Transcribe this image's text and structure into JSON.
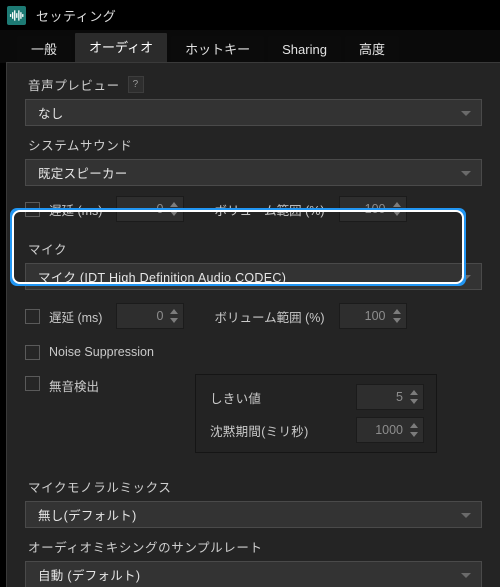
{
  "window": {
    "title": "セッティング",
    "icon": "audio-wave-icon",
    "icon_color": "#1d7a74"
  },
  "tabs": [
    {
      "id": "general",
      "label": "一般",
      "active": false
    },
    {
      "id": "audio",
      "label": "オーディオ",
      "active": true
    },
    {
      "id": "hotkey",
      "label": "ホットキー",
      "active": false
    },
    {
      "id": "sharing",
      "label": "Sharing",
      "active": false
    },
    {
      "id": "advanced",
      "label": "高度",
      "active": false
    }
  ],
  "audio": {
    "preview": {
      "label": "音声プレビュー",
      "help": "?",
      "value": "なし"
    },
    "system_sound": {
      "label": "システムサウンド",
      "value": "既定スピーカー",
      "delay_checkbox_checked": false,
      "delay_label": "遅延 (ms)",
      "delay_value": "0",
      "volume_label": "ボリューム範囲 (%)",
      "volume_value": "100"
    },
    "mic": {
      "label": "マイク",
      "value": "マイク (IDT High Definition Audio CODEC)",
      "delay_checkbox_checked": false,
      "delay_label": "遅延 (ms)",
      "delay_value": "0",
      "volume_label": "ボリューム範囲 (%)",
      "volume_value": "100"
    },
    "noise_suppression": {
      "label": "Noise Suppression",
      "checked": false
    },
    "silence_detection": {
      "label": "無音検出",
      "checked": false,
      "threshold_label": "しきい値",
      "threshold_value": "5",
      "duration_label": "沈黙期間(ミリ秒)",
      "duration_value": "1000"
    },
    "mono_mix": {
      "label": "マイクモノラルミックス",
      "value": "無し(デフォルト)"
    },
    "sample_rate": {
      "label": "オーディオミキシングのサンプルレート",
      "value": "自動 (デフォルト)"
    }
  },
  "highlight": {
    "target": "mic-section",
    "color": "#2196f3"
  }
}
